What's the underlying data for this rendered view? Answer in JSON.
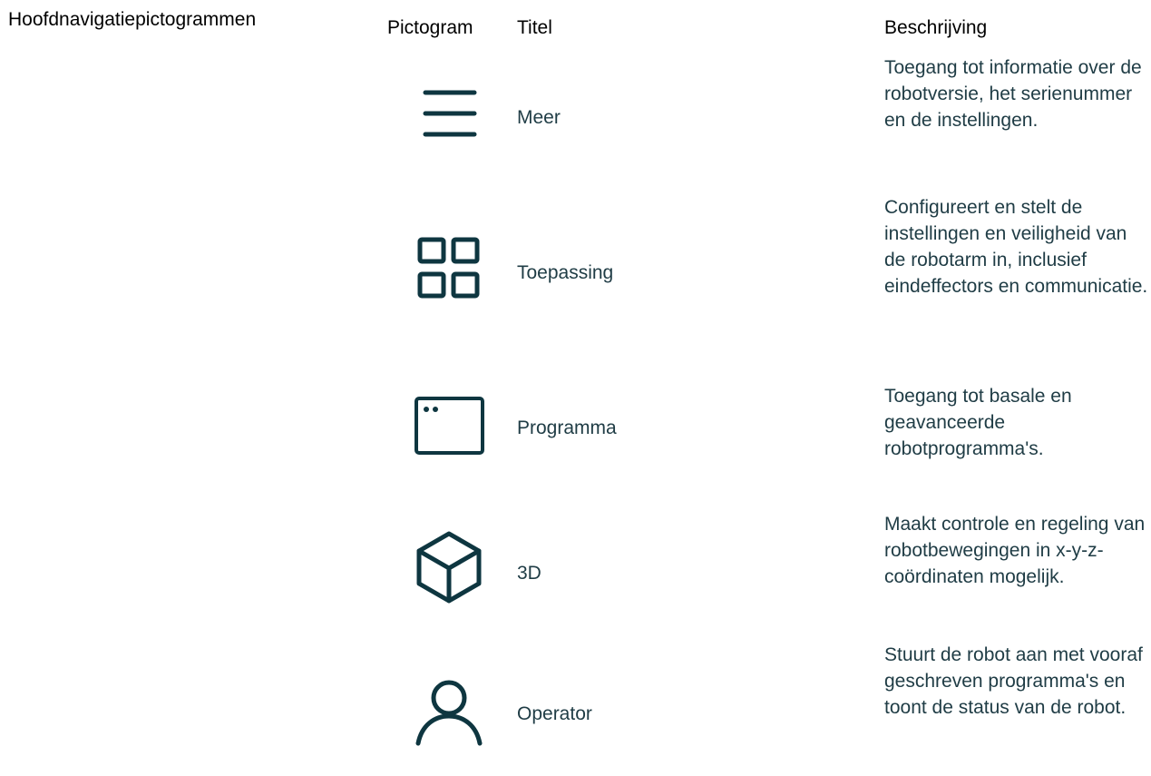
{
  "section": {
    "title": "Hoofdnavigatiepictogrammen"
  },
  "table": {
    "headers": {
      "pictogram": "Pictogram",
      "titel": "Titel",
      "beschrijving": "Beschrijving"
    },
    "rows": [
      {
        "icon": "menu-icon",
        "title": "Meer",
        "description": "Toegang tot informatie over de robotversie, het serienummer en de instellingen."
      },
      {
        "icon": "grid-icon",
        "title": "Toepassing",
        "description": "Configureert en stelt de instellingen en veiligheid van de robotarm in, inclusief eindeffectors en communicatie."
      },
      {
        "icon": "program-window-icon",
        "title": "Programma",
        "description": "Toegang tot basale en geavanceerde robotprogramma's."
      },
      {
        "icon": "cube-3d-icon",
        "title": "3D",
        "description": "Maakt controle en regeling van robotbewegingen in x-y-z-coördinaten mogelijk."
      },
      {
        "icon": "user-icon",
        "title": "Operator",
        "description": "Stuurt de robot aan met vooraf geschreven programma's en toont de status van de robot."
      }
    ]
  },
  "colors": {
    "icon_stroke": "#0e3640",
    "text_dark": "#1f3c45",
    "header_text": "#000000"
  }
}
